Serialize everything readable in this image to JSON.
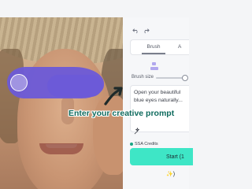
{
  "editor": {
    "undo_icon": "undo-icon",
    "redo_icon": "redo-icon",
    "tabs": [
      {
        "label": "Brush",
        "active": true
      },
      {
        "label": "A",
        "active": false
      }
    ],
    "brush_size_label": "Brush size",
    "brush_size_value": 0.92,
    "prompt_text": "Open your beautiful blue eyes naturally...",
    "prompt_tool_icon": "magic-wand-icon",
    "credits_text": "SSA Credits",
    "start_button_label": "Start (1 ✨)",
    "accent": "#3ee6c6",
    "mask_color": "#6b5ad8"
  },
  "overlay": {
    "annotation_text": "Enter your creative prompt",
    "annotation_color": "#0f6b5e"
  }
}
